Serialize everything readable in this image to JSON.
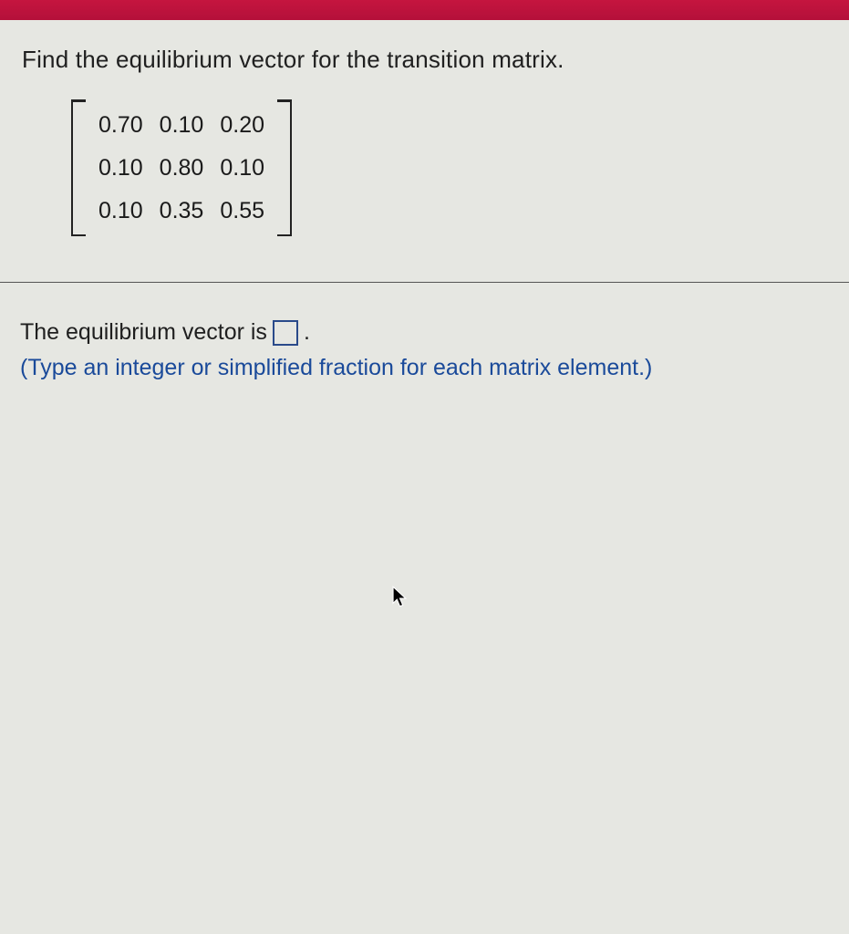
{
  "prompt": "Find the equilibrium vector for the transition matrix.",
  "matrix": {
    "r0c0": "0.70",
    "r0c1": "0.10",
    "r0c2": "0.20",
    "r1c0": "0.10",
    "r1c1": "0.80",
    "r1c2": "0.10",
    "r2c0": "0.10",
    "r2c1": "0.35",
    "r2c2": "0.55"
  },
  "answer": {
    "prefix": "The equilibrium vector is",
    "value": "",
    "suffix": "."
  },
  "hint": "(Type an integer or simplified fraction for each matrix element.)"
}
